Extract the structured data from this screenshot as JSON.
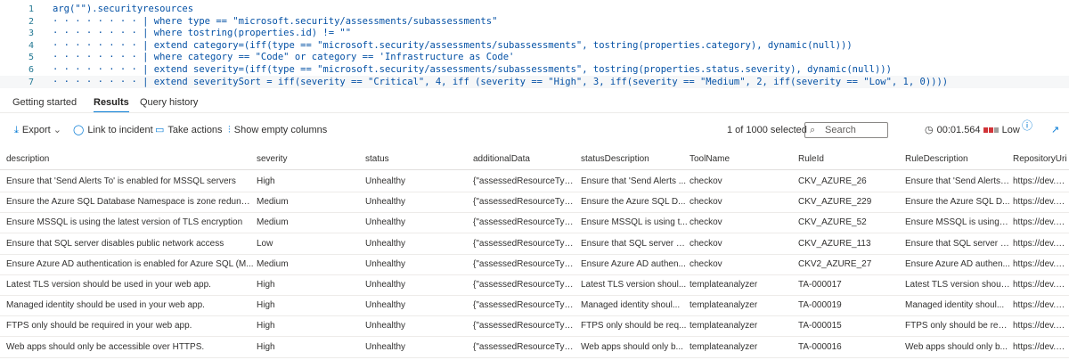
{
  "editor": {
    "lines": [
      {
        "num": "1",
        "text": "arg(\"\").securityresources"
      },
      {
        "num": "2",
        "text": "· · · · · · · · | where type == \"microsoft.security/assessments/subassessments\""
      },
      {
        "num": "3",
        "text": "· · · · · · · · | where tostring(properties.id) != \"\""
      },
      {
        "num": "4",
        "text": "· · · · · · · · | extend category=(iff(type == \"microsoft.security/assessments/subassessments\", tostring(properties.category), dynamic(null)))"
      },
      {
        "num": "5",
        "text": "· · · · · · · · | where category == \"Code\" or category == 'Infrastructure as Code'"
      },
      {
        "num": "6",
        "text": "· · · · · · · · | extend severity=(iff(type == \"microsoft.security/assessments/subassessments\", tostring(properties.status.severity), dynamic(null)))"
      },
      {
        "num": "7",
        "text": "· · · · · · · · | extend severitySort = iff(severity == \"Critical\", 4, iff (severity == \"High\", 3, iff(severity == \"Medium\", 2, iff(severity == \"Low\", 1, 0))))"
      }
    ]
  },
  "tabs": {
    "getting_started": "Getting started",
    "results": "Results",
    "query_history": "Query history"
  },
  "toolbar": {
    "export": "Export",
    "link_incident": "Link to incident",
    "take_actions": "Take actions",
    "show_empty": "Show empty columns",
    "selected": "1 of 1000 selected",
    "search_placeholder": "Search",
    "elapsed": "00:01.564",
    "perf_level": "Low"
  },
  "grid": {
    "columns": [
      "description",
      "severity",
      "status",
      "additionalData",
      "statusDescription",
      "ToolName",
      "RuleId",
      "RuleDescription",
      "RepositoryUri"
    ],
    "rows": [
      [
        "Ensure that 'Send Alerts To' is enabled for MSSQL servers",
        "High",
        "Unhealthy",
        "{\"assessedResourceType...",
        "Ensure that 'Send Alerts ...",
        "checkov",
        "CKV_AZURE_26",
        "Ensure that 'Send Alerts ...",
        "https://dev.azu"
      ],
      [
        "Ensure the Azure SQL Database Namespace is zone redundant",
        "Medium",
        "Unhealthy",
        "{\"assessedResourceType...",
        "Ensure the Azure SQL D...",
        "checkov",
        "CKV_AZURE_229",
        "Ensure the Azure SQL D...",
        "https://dev.azu"
      ],
      [
        "Ensure MSSQL is using the latest version of TLS encryption",
        "Medium",
        "Unhealthy",
        "{\"assessedResourceType...",
        "Ensure MSSQL is using t...",
        "checkov",
        "CKV_AZURE_52",
        "Ensure MSSQL is using t...",
        "https://dev.azu"
      ],
      [
        "Ensure that SQL server disables public network access",
        "Low",
        "Unhealthy",
        "{\"assessedResourceType...",
        "Ensure that SQL server d...",
        "checkov",
        "CKV_AZURE_113",
        "Ensure that SQL server d...",
        "https://dev.azu"
      ],
      [
        "Ensure Azure AD authentication is enabled for Azure SQL (M...",
        "Medium",
        "Unhealthy",
        "{\"assessedResourceType...",
        "Ensure Azure AD authen...",
        "checkov",
        "CKV2_AZURE_27",
        "Ensure Azure AD authen...",
        "https://dev.azu"
      ],
      [
        "Latest TLS version should be used in your web app.",
        "High",
        "Unhealthy",
        "{\"assessedResourceType...",
        "Latest TLS version shoul...",
        "templateanalyzer",
        "TA-000017",
        "Latest TLS version shoul...",
        "https://dev.azu"
      ],
      [
        "Managed identity should be used in your web app.",
        "High",
        "Unhealthy",
        "{\"assessedResourceType...",
        "Managed identity shoul...",
        "templateanalyzer",
        "TA-000019",
        "Managed identity shoul...",
        "https://dev.azu"
      ],
      [
        "FTPS only should be required in your web app.",
        "High",
        "Unhealthy",
        "{\"assessedResourceType...",
        "FTPS only should be req...",
        "templateanalyzer",
        "TA-000015",
        "FTPS only should be req...",
        "https://dev.azu"
      ],
      [
        "Web apps should only be accessible over HTTPS.",
        "High",
        "Unhealthy",
        "{\"assessedResourceType...",
        "Web apps should only b...",
        "templateanalyzer",
        "TA-000016",
        "Web apps should only b...",
        "https://dev.azu"
      ]
    ]
  }
}
